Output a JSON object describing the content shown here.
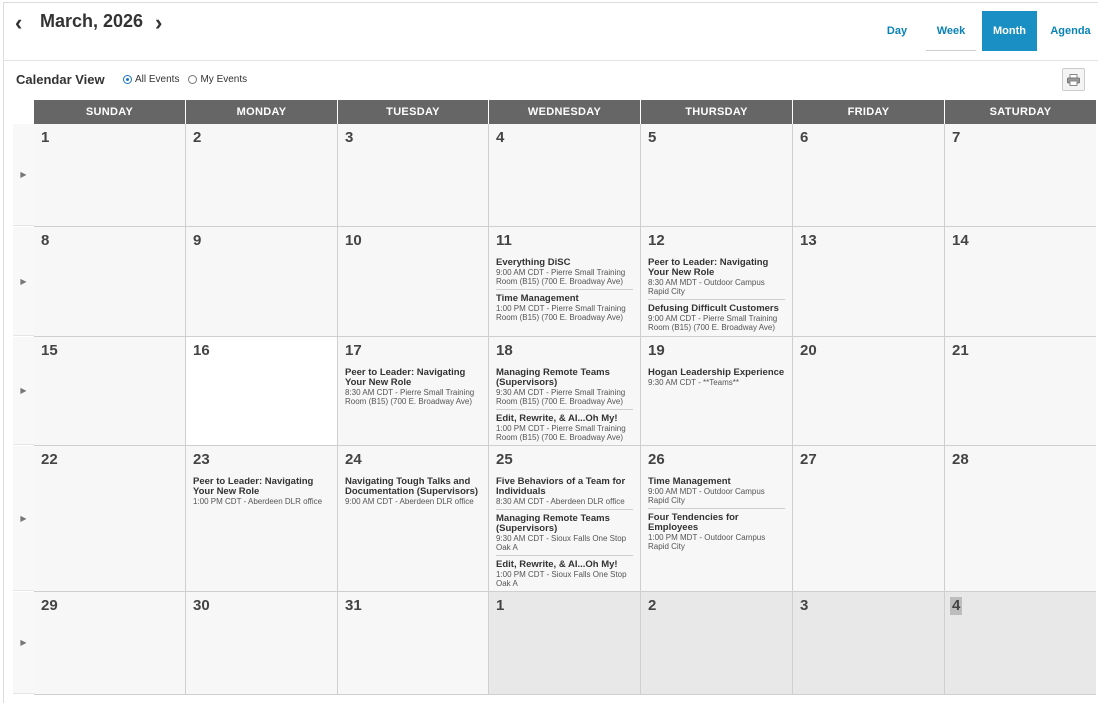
{
  "header": {
    "title": "March, 2026",
    "prev_icon": "chevron-left-icon",
    "next_icon": "chevron-right-icon",
    "views": [
      {
        "label": "Day",
        "active": false
      },
      {
        "label": "Week",
        "active": false
      },
      {
        "label": "Month",
        "active": true
      },
      {
        "label": "Agenda",
        "active": false
      }
    ]
  },
  "toolbar": {
    "calendar_view_label": "Calendar View",
    "filter_all": "All Events",
    "filter_mine": "My Events",
    "filter_selected": "All Events",
    "print_icon": "printer-icon"
  },
  "colors": {
    "accent": "#1a8fc3",
    "link": "#0a82b6",
    "dow_header_bg": "#666666",
    "cell_bg": "#f7f7f7",
    "other_month_bg": "#e8e8e8"
  },
  "days_of_week": [
    "SUNDAY",
    "MONDAY",
    "TUESDAY",
    "WEDNESDAY",
    "THURSDAY",
    "FRIDAY",
    "SATURDAY"
  ],
  "weeks": [
    {
      "days": [
        {
          "num": "1",
          "events": []
        },
        {
          "num": "2",
          "events": []
        },
        {
          "num": "3",
          "events": []
        },
        {
          "num": "4",
          "events": []
        },
        {
          "num": "5",
          "events": []
        },
        {
          "num": "6",
          "events": []
        },
        {
          "num": "7",
          "events": []
        }
      ]
    },
    {
      "days": [
        {
          "num": "8",
          "events": []
        },
        {
          "num": "9",
          "events": []
        },
        {
          "num": "10",
          "events": []
        },
        {
          "num": "11",
          "events": [
            {
              "title": "Everything DiSC",
              "details": [
                "9:00 AM CDT - Pierre Small Training",
                "Room (B15) (700 E. Broadway Ave)"
              ]
            },
            {
              "title": "Time Management",
              "details": [
                "1:00 PM CDT - Pierre Small Training",
                "Room (B15) (700 E. Broadway Ave)"
              ]
            }
          ]
        },
        {
          "num": "12",
          "events": [
            {
              "title": "Peer to Leader: Navigating Your New Role",
              "details": [
                "8:30 AM MDT - Outdoor Campus",
                "Rapid City"
              ]
            },
            {
              "title": "Defusing Difficult Customers",
              "details": [
                "9:00 AM CDT - Pierre Small Training",
                "Room (B15) (700 E. Broadway Ave)"
              ]
            }
          ]
        },
        {
          "num": "13",
          "events": []
        },
        {
          "num": "14",
          "events": []
        }
      ]
    },
    {
      "days": [
        {
          "num": "15",
          "events": []
        },
        {
          "num": "16",
          "today": true,
          "events": []
        },
        {
          "num": "17",
          "events": [
            {
              "title": "Peer to Leader: Navigating Your New Role",
              "details": [
                "8:30 AM CDT - Pierre Small Training",
                "Room (B15) (700 E. Broadway Ave)"
              ]
            }
          ]
        },
        {
          "num": "18",
          "events": [
            {
              "title": "Managing Remote Teams (Supervisors)",
              "details": [
                "9:30 AM CDT - Pierre Small Training",
                "Room (B15) (700 E. Broadway Ave)"
              ]
            },
            {
              "title": "Edit, Rewrite, & AI...Oh My!",
              "details": [
                "1:00 PM CDT - Pierre Small Training",
                "Room (B15) (700 E. Broadway Ave)"
              ]
            }
          ]
        },
        {
          "num": "19",
          "events": [
            {
              "title": "Hogan Leadership Experience",
              "details": [
                "9:30 AM CDT - **Teams**"
              ]
            }
          ]
        },
        {
          "num": "20",
          "events": []
        },
        {
          "num": "21",
          "events": []
        }
      ]
    },
    {
      "days": [
        {
          "num": "22",
          "events": []
        },
        {
          "num": "23",
          "events": [
            {
              "title": "Peer to Leader: Navigating Your New Role",
              "details": [
                "1:00 PM CDT - Aberdeen DLR office"
              ]
            }
          ]
        },
        {
          "num": "24",
          "events": [
            {
              "title": "Navigating Tough Talks and Documentation (Supervisors)",
              "details": [
                "9:00 AM CDT - Aberdeen DLR office"
              ]
            }
          ]
        },
        {
          "num": "25",
          "events": [
            {
              "title": "Five Behaviors of a Team for Individuals",
              "details": [
                "8:30 AM CDT - Aberdeen DLR office"
              ]
            },
            {
              "title": "Managing Remote Teams (Supervisors)",
              "details": [
                "9:30 AM CDT - Sioux Falls One Stop",
                "Oak A"
              ]
            },
            {
              "title": "Edit, Rewrite, & AI...Oh My!",
              "details": [
                "1:00 PM CDT - Sioux Falls One Stop",
                "Oak A"
              ]
            }
          ]
        },
        {
          "num": "26",
          "events": [
            {
              "title": "Time Management",
              "details": [
                "9:00 AM MDT - Outdoor Campus",
                "Rapid City"
              ]
            },
            {
              "title": "Four Tendencies for Employees",
              "details": [
                "1:00 PM MDT - Outdoor Campus",
                "Rapid City"
              ]
            }
          ]
        },
        {
          "num": "27",
          "events": []
        },
        {
          "num": "28",
          "events": []
        }
      ]
    },
    {
      "days": [
        {
          "num": "29",
          "events": []
        },
        {
          "num": "30",
          "events": []
        },
        {
          "num": "31",
          "events": []
        },
        {
          "num": "1",
          "other": true,
          "events": []
        },
        {
          "num": "2",
          "other": true,
          "events": []
        },
        {
          "num": "3",
          "other": true,
          "events": []
        },
        {
          "num": "4",
          "other": true,
          "highlight": true,
          "events": []
        }
      ]
    }
  ]
}
